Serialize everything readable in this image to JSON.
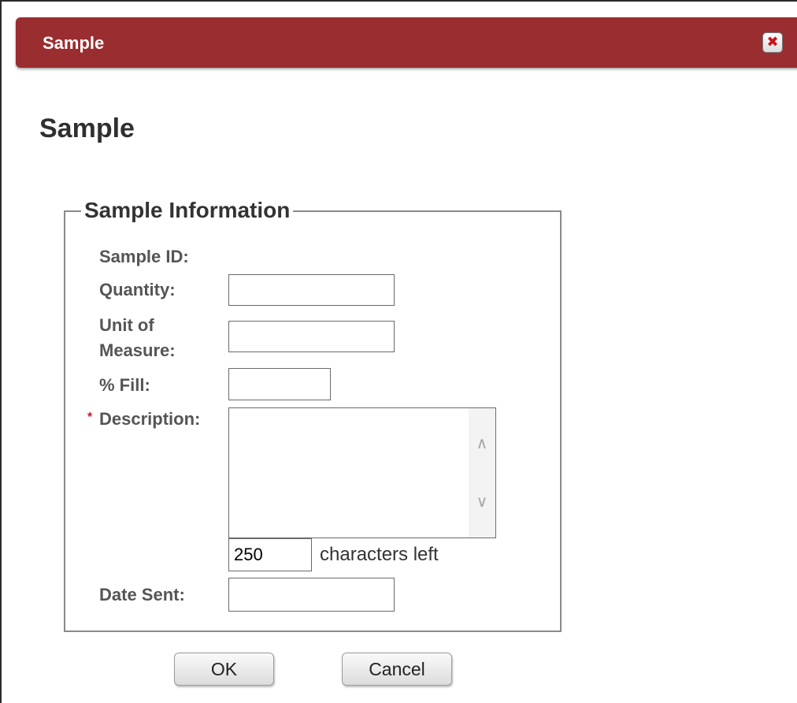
{
  "window": {
    "title": "Sample",
    "close_glyph": "✖",
    "close_icon": "close-icon"
  },
  "page": {
    "heading": "Sample"
  },
  "fieldset": {
    "legend": "Sample Information"
  },
  "fields": {
    "sample_id_label": "Sample ID:",
    "quantity_label": "Quantity:",
    "quantity_value": "",
    "unit_label_line1": "Unit of",
    "unit_label_line2": "Measure:",
    "unit_value": "",
    "fill_label": "% Fill:",
    "fill_value": "",
    "required_marker": "*",
    "description_label": "Description:",
    "description_value": "",
    "chars_count": "250",
    "chars_suffix": "characters left",
    "date_sent_label": "Date Sent:",
    "date_sent_value": ""
  },
  "scroll": {
    "up_glyph": "∧",
    "down_glyph": "∨"
  },
  "buttons": {
    "ok": "OK",
    "cancel": "Cancel"
  },
  "colors": {
    "titlebar": "#9a2d30",
    "required": "#c0182a"
  }
}
